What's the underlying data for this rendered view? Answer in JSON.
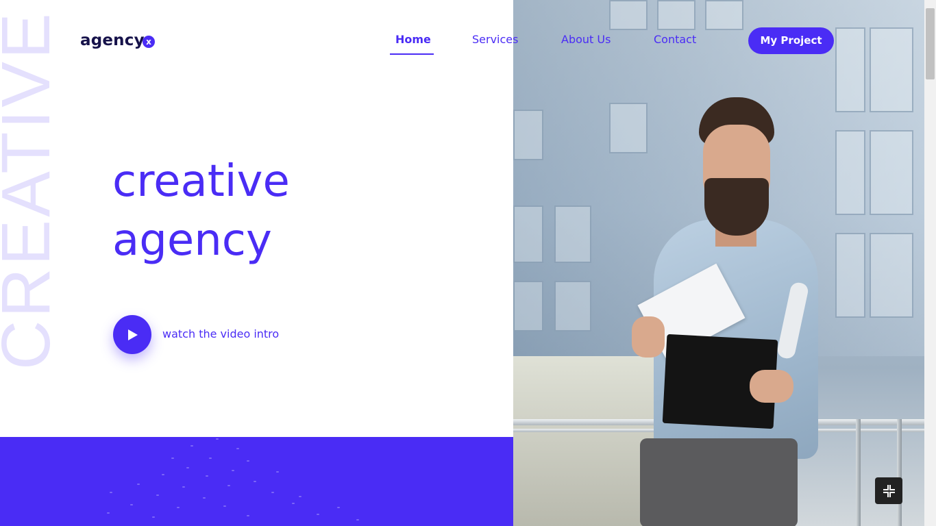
{
  "brand": {
    "name": "agency",
    "badge": "x"
  },
  "nav": {
    "items": [
      {
        "label": "Home",
        "active": true
      },
      {
        "label": "Services",
        "active": false
      },
      {
        "label": "About Us",
        "active": false
      },
      {
        "label": "Contact",
        "active": false
      }
    ],
    "cta_label": "My Project"
  },
  "hero": {
    "vertical_word": "CREATIVE",
    "title_line1": "creative",
    "title_line2": "agency",
    "video_label": "watch the video intro"
  },
  "icons": {
    "play": "play-icon",
    "fullscreen": "exit-fullscreen-icon",
    "logo_badge": "x-badge-icon"
  },
  "colors": {
    "accent": "#4a2cf5",
    "brand_text": "#16124a",
    "watermark": "#e4e0fd"
  }
}
